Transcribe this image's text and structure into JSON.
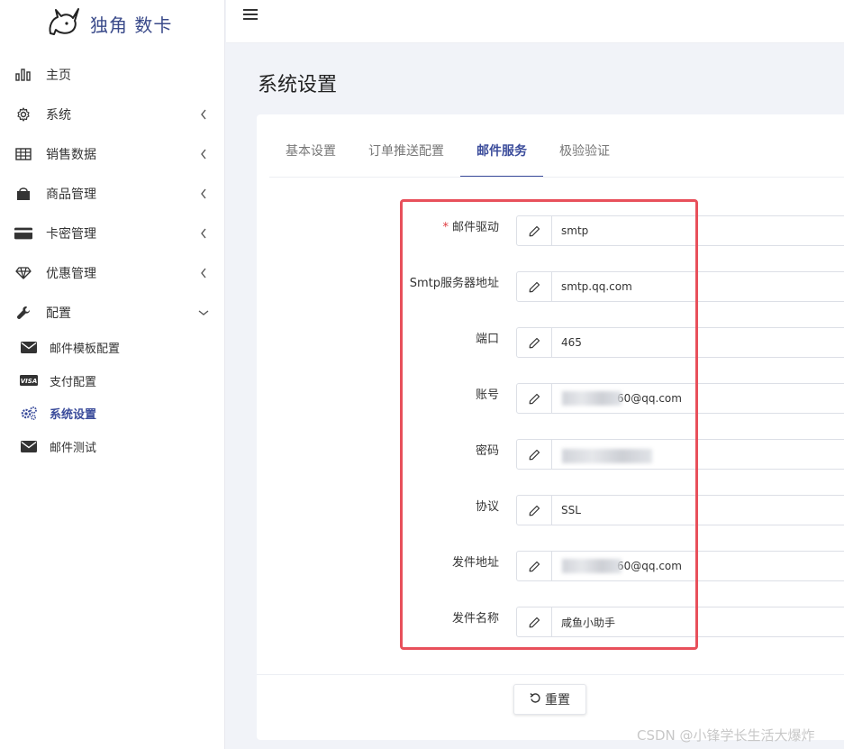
{
  "app": {
    "logo_text": "独角 数卡"
  },
  "sidebar": {
    "items": [
      {
        "label": "主页",
        "icon": "bar-chart-icon",
        "has_chevron": false
      },
      {
        "label": "系统",
        "icon": "gear-icon",
        "chevron": "chevron-left"
      },
      {
        "label": "销售数据",
        "icon": "table-icon",
        "chevron": "chevron-left"
      },
      {
        "label": "商品管理",
        "icon": "shopping-bag-icon",
        "chevron": "chevron-left"
      },
      {
        "label": "卡密管理",
        "icon": "credit-card-icon",
        "chevron": "chevron-left"
      },
      {
        "label": "优惠管理",
        "icon": "diamond-icon",
        "chevron": "chevron-left"
      },
      {
        "label": "配置",
        "icon": "wrench-icon",
        "chevron": "chevron-down"
      }
    ],
    "sub_items": [
      {
        "label": "邮件模板配置",
        "icon": "envelope-icon"
      },
      {
        "label": "支付配置",
        "icon": "visa-card-icon"
      },
      {
        "label": "系统设置",
        "icon": "gears-icon",
        "active": true
      },
      {
        "label": "邮件测试",
        "icon": "envelope-icon"
      }
    ]
  },
  "page": {
    "title": "系统设置"
  },
  "tabs": [
    {
      "label": "基本设置",
      "active": false
    },
    {
      "label": "订单推送配置",
      "active": false
    },
    {
      "label": "邮件服务",
      "active": true
    },
    {
      "label": "极验验证",
      "active": false
    }
  ],
  "form": {
    "fields": [
      {
        "label": "邮件驱动",
        "required": true,
        "value": "smtp",
        "obscured": false
      },
      {
        "label": "Smtp服务器地址",
        "required": false,
        "value": "smtp.qq.com",
        "obscured": false
      },
      {
        "label": "端口",
        "required": false,
        "value": "465",
        "obscured": false
      },
      {
        "label": "账号",
        "required": false,
        "value": "60@qq.com",
        "obscured": "partial"
      },
      {
        "label": "密码",
        "required": false,
        "value": "",
        "obscured": "full"
      },
      {
        "label": "协议",
        "required": false,
        "value": "SSL",
        "obscured": false
      },
      {
        "label": "发件地址",
        "required": false,
        "value": "60@qq.com",
        "obscured": "partial"
      },
      {
        "label": "发件名称",
        "required": false,
        "value": "咸鱼小助手",
        "obscured": false
      }
    ],
    "reset_label": "重置"
  },
  "colors": {
    "accent": "#3b4c9b",
    "highlight": "#e8505b",
    "required": "#e0393e"
  },
  "watermark": "CSDN @小锋学长生活大爆炸"
}
